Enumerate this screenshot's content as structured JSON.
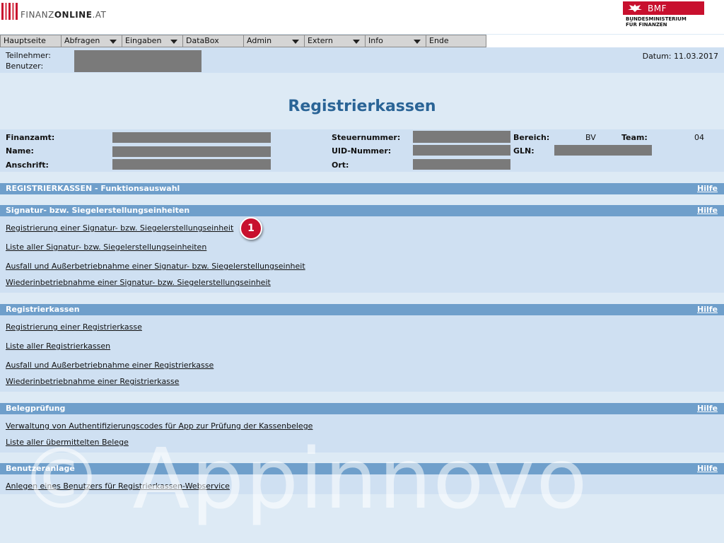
{
  "header": {
    "logo_strong": "FINANZ",
    "logo_bold": "ONLINE",
    "logo_tail": ".AT",
    "bmf_label": "BMF",
    "bmf_sub1": "BUNDESMINISTERIUM",
    "bmf_sub2": "FÜR FINANZEN"
  },
  "menu": [
    {
      "label": "Hauptseite",
      "dropdown": false
    },
    {
      "label": "Abfragen",
      "dropdown": true
    },
    {
      "label": "Eingaben",
      "dropdown": true
    },
    {
      "label": "DataBox",
      "dropdown": false
    },
    {
      "label": "Admin",
      "dropdown": true
    },
    {
      "label": "Extern",
      "dropdown": true
    },
    {
      "label": "Info",
      "dropdown": true
    },
    {
      "label": "Ende",
      "dropdown": false
    }
  ],
  "user": {
    "participant_label": "Teilnehmer:",
    "user_label": "Benutzer:",
    "date_text": "Datum: 11.03.2017"
  },
  "page": {
    "title": "Registrierkassen"
  },
  "info": {
    "finanzamt_label": "Finanzamt:",
    "name_label": "Name:",
    "anschrift_label": "Anschrift:",
    "steuernummer_label": "Steuernummer:",
    "uid_label": "UID-Nummer:",
    "ort_label": "Ort:",
    "bereich_label": "Bereich:",
    "bereich_value": "BV",
    "team_label": "Team:",
    "team_value": "04",
    "gln_label": "GLN:"
  },
  "sections": {
    "funktion": {
      "title": "REGISTRIERKASSEN - Funktionsauswahl",
      "help": "Hilfe"
    },
    "signatur": {
      "title": "Signatur- bzw. Siegelerstellungseinheiten",
      "help": "Hilfe",
      "links": [
        "Registrierung einer Signatur- bzw. Siegelerstellungseinheit",
        "Liste aller Signatur- bzw. Siegelerstellungseinheiten",
        "Ausfall und Außerbetriebnahme einer Signatur- bzw. Siegelerstellungseinheit",
        "Wiederinbetriebnahme einer Signatur- bzw. Siegelerstellungseinheit"
      ]
    },
    "kassen": {
      "title": "Registrierkassen",
      "help": "Hilfe",
      "links": [
        "Registrierung einer Registrierkasse",
        "Liste aller Registrierkassen",
        "Ausfall und Außerbetriebnahme einer Registrierkasse",
        "Wiederinbetriebnahme einer Registrierkasse"
      ]
    },
    "beleg": {
      "title": "Belegprüfung",
      "help": "Hilfe",
      "links": [
        "Verwaltung von Authentifizierungscodes für App zur Prüfung der Kassenbelege",
        "Liste aller übermittelten Belege"
      ]
    },
    "benutzer": {
      "title": "Benutzeranlage",
      "help": "Hilfe",
      "links": [
        "Anlegen eines Benutzers für Registrierkassen-Webservice"
      ]
    }
  },
  "annotation": {
    "badge": "1"
  },
  "watermark": "© Appinnovo",
  "colors": {
    "brand_red": "#c8102e",
    "section_blue": "#6f9fcb",
    "panel_blue": "#cfe0f2",
    "title_blue": "#2a6496"
  }
}
